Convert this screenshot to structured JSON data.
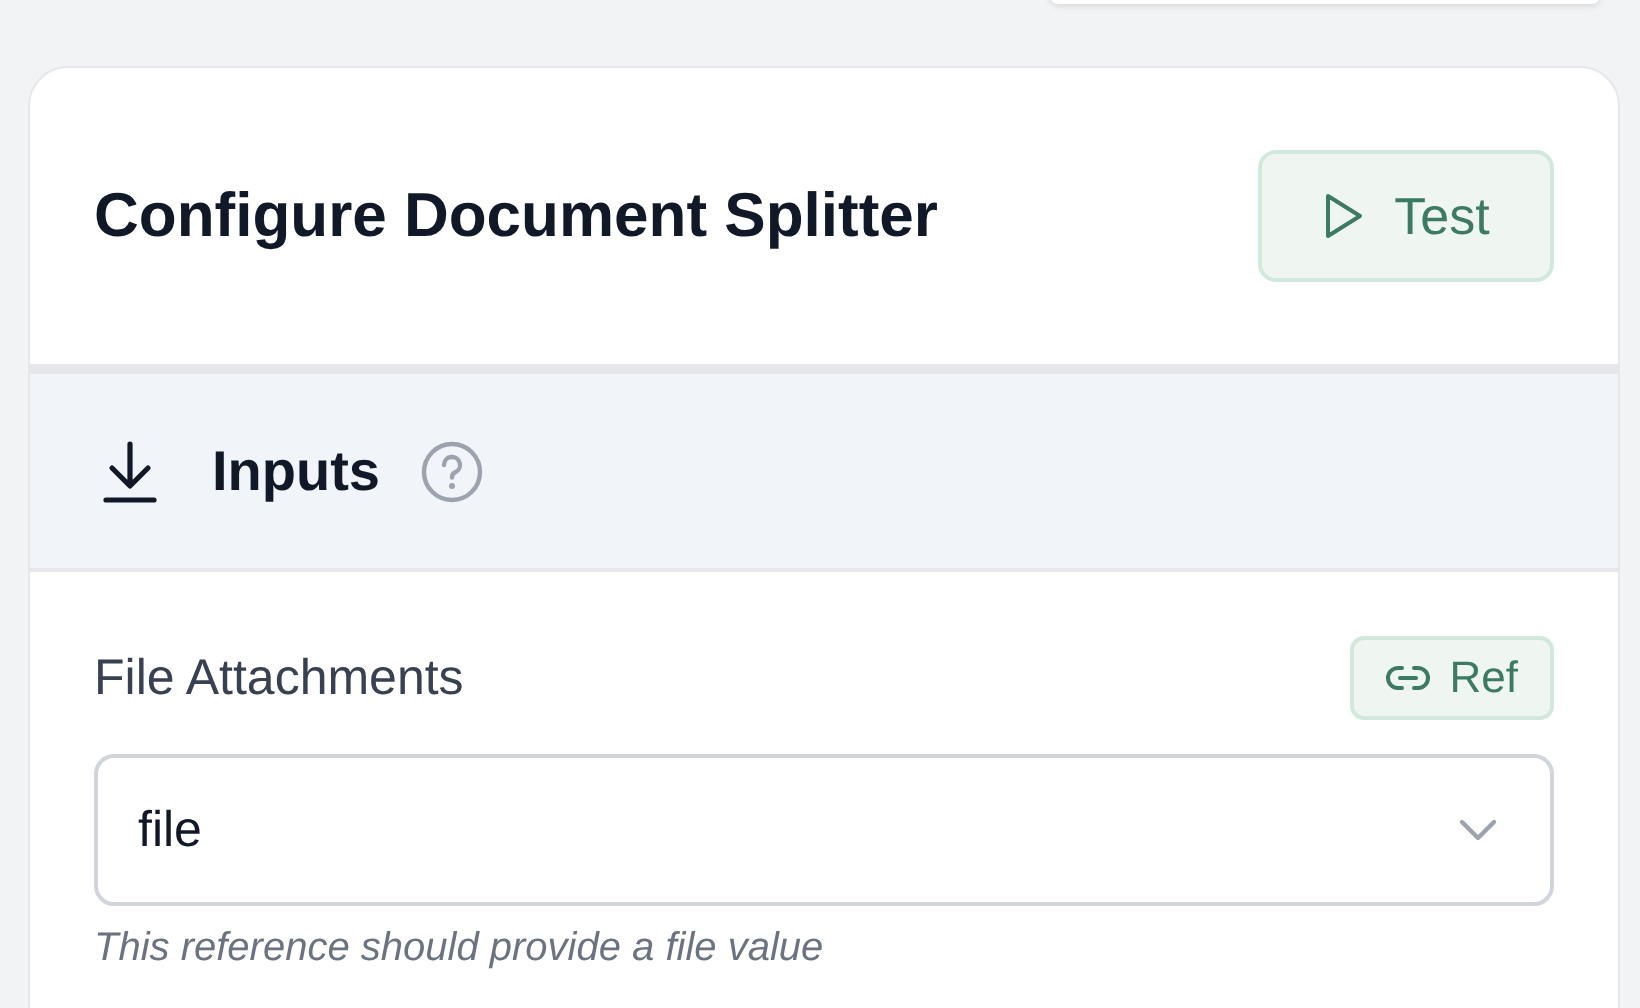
{
  "panel": {
    "title": "Configure Document Splitter",
    "test_button": "Test"
  },
  "section": {
    "title": "Inputs"
  },
  "fields": [
    {
      "label": "File Attachments",
      "ref_button": "Ref",
      "value": "file",
      "hint": "This reference should provide a file value"
    }
  ]
}
